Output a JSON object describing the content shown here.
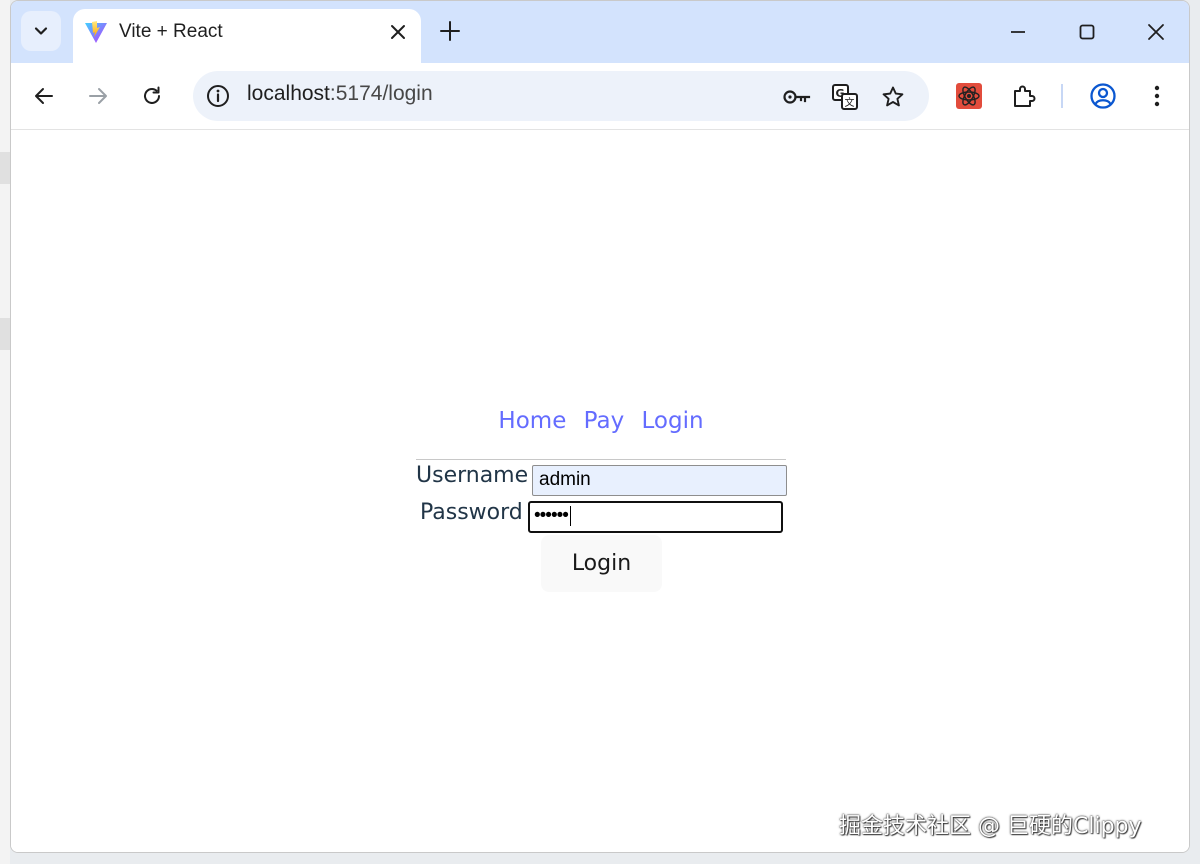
{
  "browser": {
    "tab_title": "Vite + React",
    "url_host": "localhost",
    "url_rest": ":5174/login"
  },
  "nav": {
    "home": "Home",
    "pay": "Pay",
    "login": "Login"
  },
  "form": {
    "username_label": "Username",
    "username_value": "admin",
    "password_label": "Password",
    "password_masked": "••••••",
    "submit_label": "Login"
  },
  "watermark": "掘金技术社区 @ 巨硬的Clippy",
  "colors": {
    "link": "#646cff",
    "tabbar": "#d3e3fd",
    "omnibox": "#edf2fa"
  }
}
